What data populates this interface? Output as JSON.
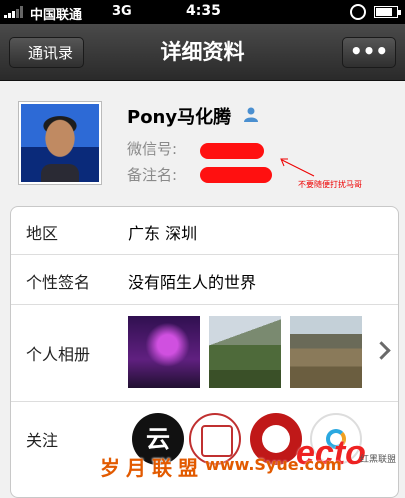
{
  "status_bar": {
    "carrier": "中国联通",
    "network": "3G",
    "time": "4:35"
  },
  "nav": {
    "back_label": "通讯录",
    "title": "详细资料",
    "more_label": "•••"
  },
  "profile": {
    "name": "Pony马化腾",
    "wechat_id_label": "微信号:",
    "note_label": "备注名:",
    "annotation": "不要随便打扰马哥"
  },
  "details": {
    "region": {
      "label": "地区",
      "value": "广东  深圳"
    },
    "signature": {
      "label": "个性签名",
      "value": "没有陌生人的世界"
    },
    "album": {
      "label": "个人相册"
    },
    "follow": {
      "label": "关注",
      "first_badge": "云"
    }
  },
  "watermark": {
    "left": "岁月联盟",
    "url": "www.Syue.com",
    "logo": "ecto",
    "sub": "红黑联盟"
  },
  "colors": {
    "redaction": "#ff1010",
    "annotation": "#e00000",
    "watermark": "#e25a00"
  }
}
